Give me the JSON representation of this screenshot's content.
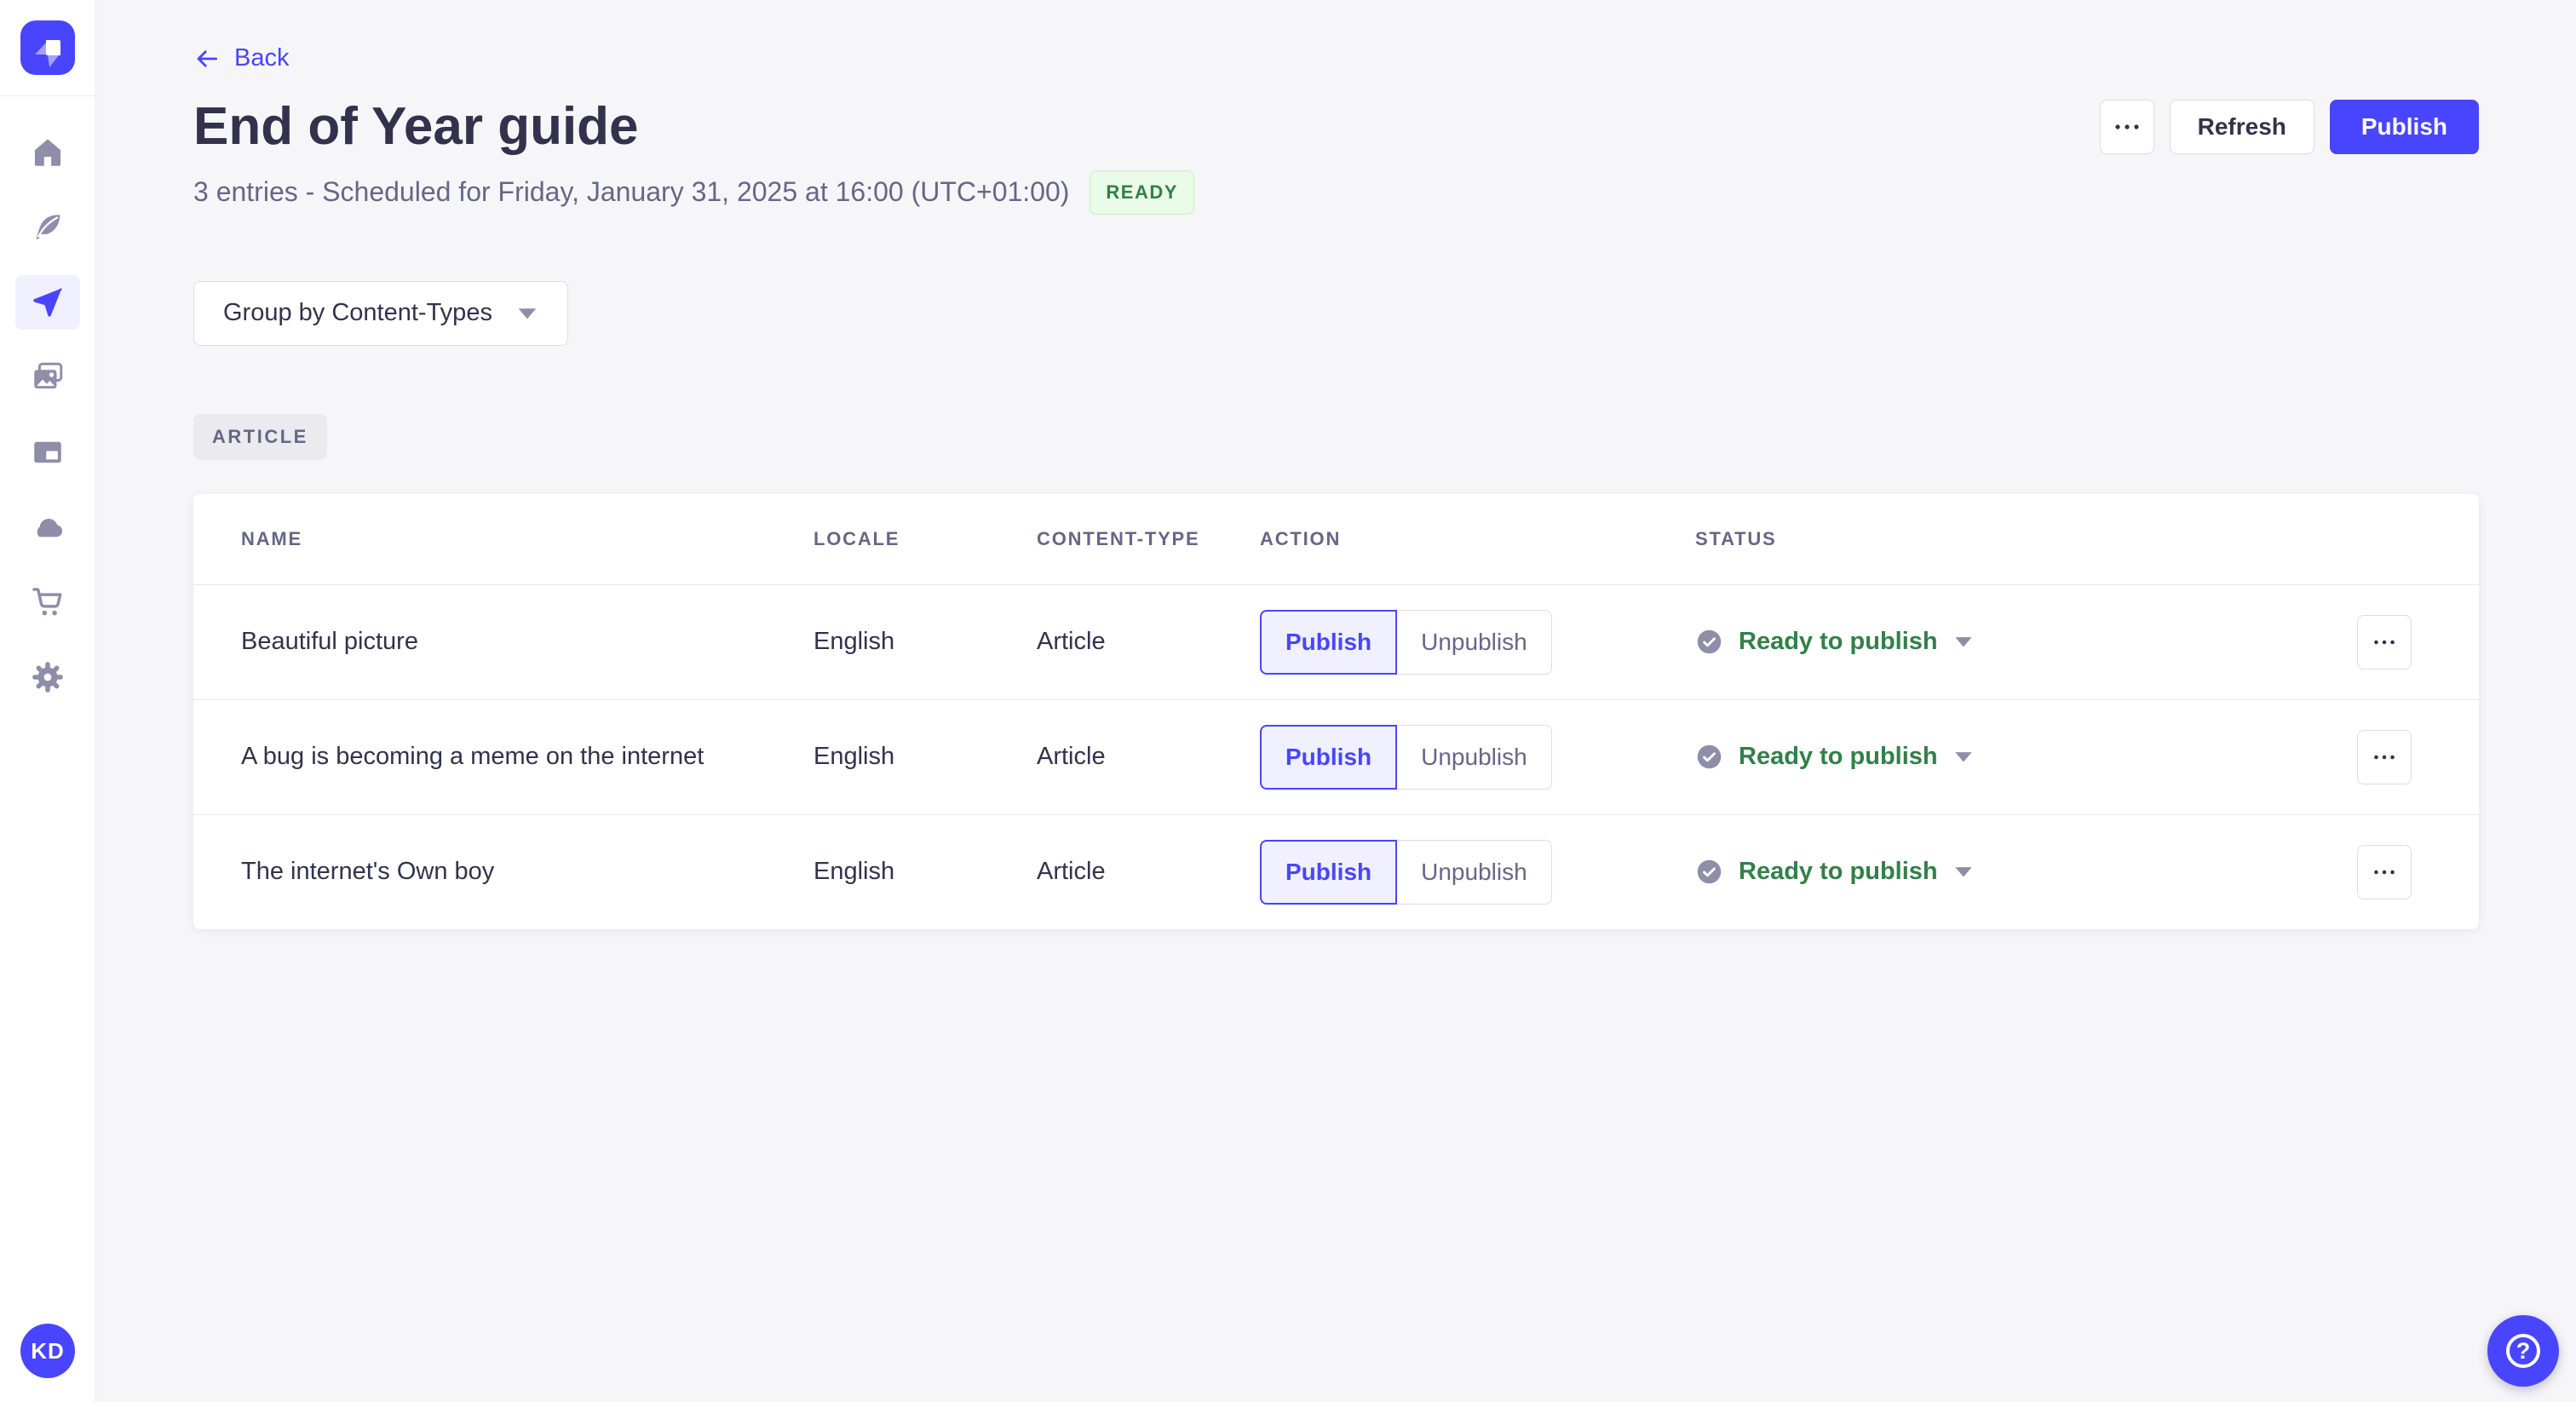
{
  "colors": {
    "primary": "#4945FF",
    "primary_light": "#F0F0FF",
    "success_text": "#328048",
    "success_bg": "#EAFBE7",
    "success_border": "#C6F0C2",
    "neutral_text": "#32324D",
    "muted_text": "#666687",
    "icon_gray": "#8E8EA9",
    "border": "#DCDCE4",
    "divider": "#EAEAEF",
    "page_bg": "#F6F6F9",
    "card_bg": "#FFFFFF"
  },
  "sidebar": {
    "logo_icon": "strapi-logo-icon",
    "nav_icons": [
      "home-icon",
      "feather-icon",
      "paper-plane-icon",
      "media-library-icon",
      "layout-icon",
      "cloud-icon",
      "shopping-cart-icon",
      "gear-icon"
    ],
    "active_icon": "paper-plane-icon",
    "avatar_initials": "KD"
  },
  "header": {
    "back_label": "Back",
    "title": "End of Year guide",
    "subtitle": "3 entries - Scheduled for Friday, January 31, 2025 at 16:00 (UTC+01:00)",
    "status_badge": "READY",
    "actions": {
      "more_icon": "ellipsis-icon",
      "refresh": "Refresh",
      "publish": "Publish"
    }
  },
  "toolbar": {
    "group_by_label": "Group by Content-Types",
    "caret_icon": "chevron-down-icon"
  },
  "content_group": {
    "label": "ARTICLE"
  },
  "table": {
    "columns": {
      "name": "NAME",
      "locale": "LOCALE",
      "content_type": "CONTENT-TYPE",
      "action": "ACTION",
      "status": "STATUS"
    },
    "action_labels": {
      "publish": "Publish",
      "unpublish": "Unpublish"
    },
    "rows": [
      {
        "name": "Beautiful picture",
        "locale": "English",
        "content_type": "Article",
        "status": "Ready to publish"
      },
      {
        "name": "A bug is becoming a meme on the internet",
        "locale": "English",
        "content_type": "Article",
        "status": "Ready to publish"
      },
      {
        "name": "The internet's Own boy",
        "locale": "English",
        "content_type": "Article",
        "status": "Ready to publish"
      }
    ]
  },
  "help": {
    "label": "?"
  }
}
